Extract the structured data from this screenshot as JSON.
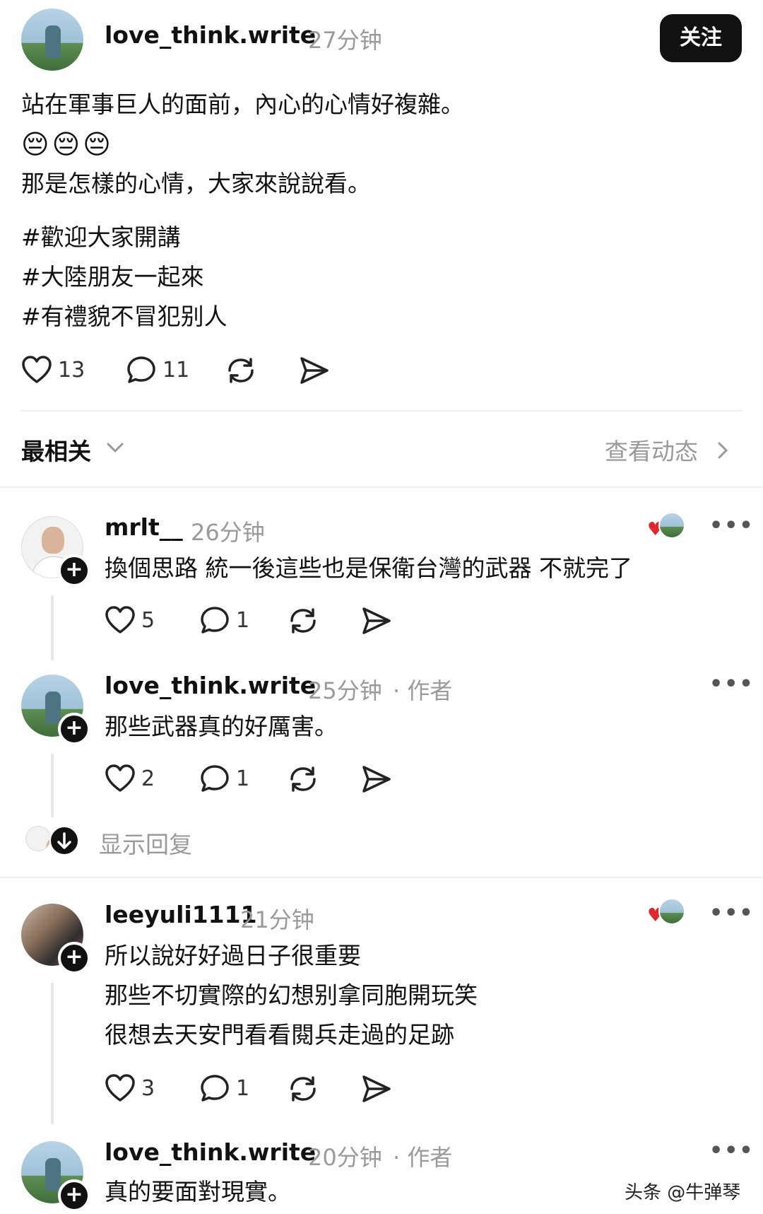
{
  "post": {
    "username": "love_think.write",
    "time": "27分钟",
    "follow_label": "关注",
    "lines": [
      "站在軍事巨人的面前，內心的心情好複雜。",
      "😔😔😔",
      "那是怎樣的心情，大家來說說看。"
    ],
    "tags": [
      "#歡迎大家開講",
      "#大陸朋友一起來",
      "#有禮貌不冒犯别人"
    ],
    "likes": "13",
    "comments": "11"
  },
  "sort": {
    "label": "最相关",
    "activity_label": "查看动态"
  },
  "comments": [
    {
      "username": "mrlt__",
      "time": "26分钟",
      "author_tag": "",
      "lines": [
        "換個思路 統一後這些也是保衛台灣的武器 不就完了"
      ],
      "likes": "5",
      "replies": "1"
    },
    {
      "username": "love_think.write",
      "time": "25分钟",
      "author_tag": "· 作者",
      "lines": [
        "那些武器真的好厲害。"
      ],
      "likes": "2",
      "replies": "1"
    },
    {
      "username": "leeyuli1111",
      "time": "21分钟",
      "author_tag": "",
      "lines": [
        "所以說好好過日子很重要",
        "那些不切實際的幻想别拿同胞開玩笑",
        "很想去天安門看看閱兵走過的足跡"
      ],
      "likes": "3",
      "replies": "1"
    },
    {
      "username": "love_think.write",
      "time": "20分钟",
      "author_tag": "· 作者",
      "lines": [
        "真的要面對現實。"
      ],
      "likes": "",
      "replies": ""
    }
  ],
  "show_replies_label": "显示回复",
  "watermark": "头条 @牛弹琴",
  "colors": {
    "accent": "#111111",
    "muted": "#9a9a9a",
    "heart": "#e0262f"
  }
}
